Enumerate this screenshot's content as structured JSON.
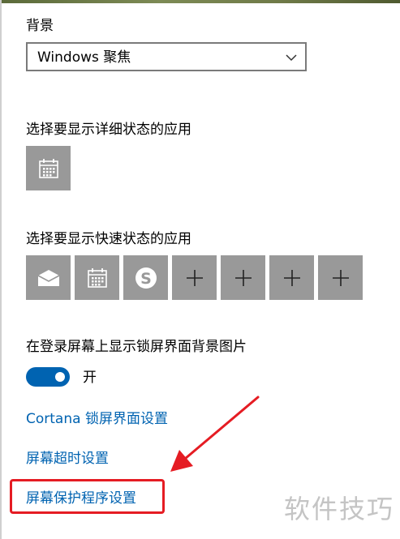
{
  "background": {
    "label": "背景",
    "dropdown_value": "Windows 聚焦"
  },
  "detailed_status": {
    "label": "选择要显示详细状态的应用",
    "apps": [
      {
        "icon": "calendar-icon"
      }
    ]
  },
  "quick_status": {
    "label": "选择要显示快速状态的应用",
    "apps": [
      {
        "icon": "mail-icon"
      },
      {
        "icon": "calendar-icon"
      },
      {
        "icon": "skype-icon"
      },
      {
        "icon": "plus-icon"
      },
      {
        "icon": "plus-icon"
      },
      {
        "icon": "plus-icon"
      },
      {
        "icon": "plus-icon"
      }
    ]
  },
  "signin_background": {
    "label": "在登录屏幕上显示锁屏界面背景图片",
    "toggle_state": "开",
    "toggle_on": true
  },
  "links": {
    "cortana": "Cortana 锁屏界面设置",
    "screen_timeout": "屏幕超时设置",
    "screen_saver": "屏幕保护程序设置"
  },
  "watermark": "软件技巧",
  "colors": {
    "accent": "#0063b1",
    "tile": "#999999",
    "highlight": "#e51c23"
  }
}
